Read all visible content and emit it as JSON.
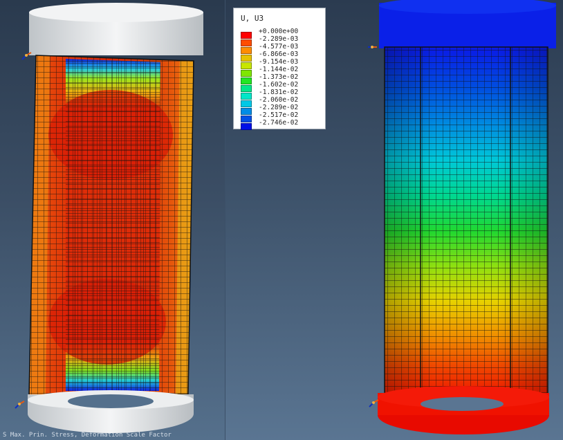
{
  "legend": {
    "title": "U, U3",
    "values": [
      "+0.000e+00",
      "-2.289e-03",
      "-4.577e-03",
      "-6.866e-03",
      "-9.154e-03",
      "-1.144e-02",
      "-1.373e-02",
      "-1.602e-02",
      "-1.831e-02",
      "-2.060e-02",
      "-2.289e-02",
      "-2.517e-02",
      "-2.746e-02"
    ],
    "colors": [
      "#ff0000",
      "#ff4d00",
      "#ff8c00",
      "#e6c200",
      "#c8e600",
      "#7fe600",
      "#22e622",
      "#00e68a",
      "#00e6c8",
      "#00c8e6",
      "#008ce6",
      "#0050e6",
      "#0010e6"
    ]
  },
  "left_view": {
    "caption": "left-deformed-specimen"
  },
  "right_view": {
    "caption": "right-deformed-specimen"
  },
  "status_bar": {
    "text": "S  Max. Prin. Stress, Deformation Scale Factor"
  }
}
